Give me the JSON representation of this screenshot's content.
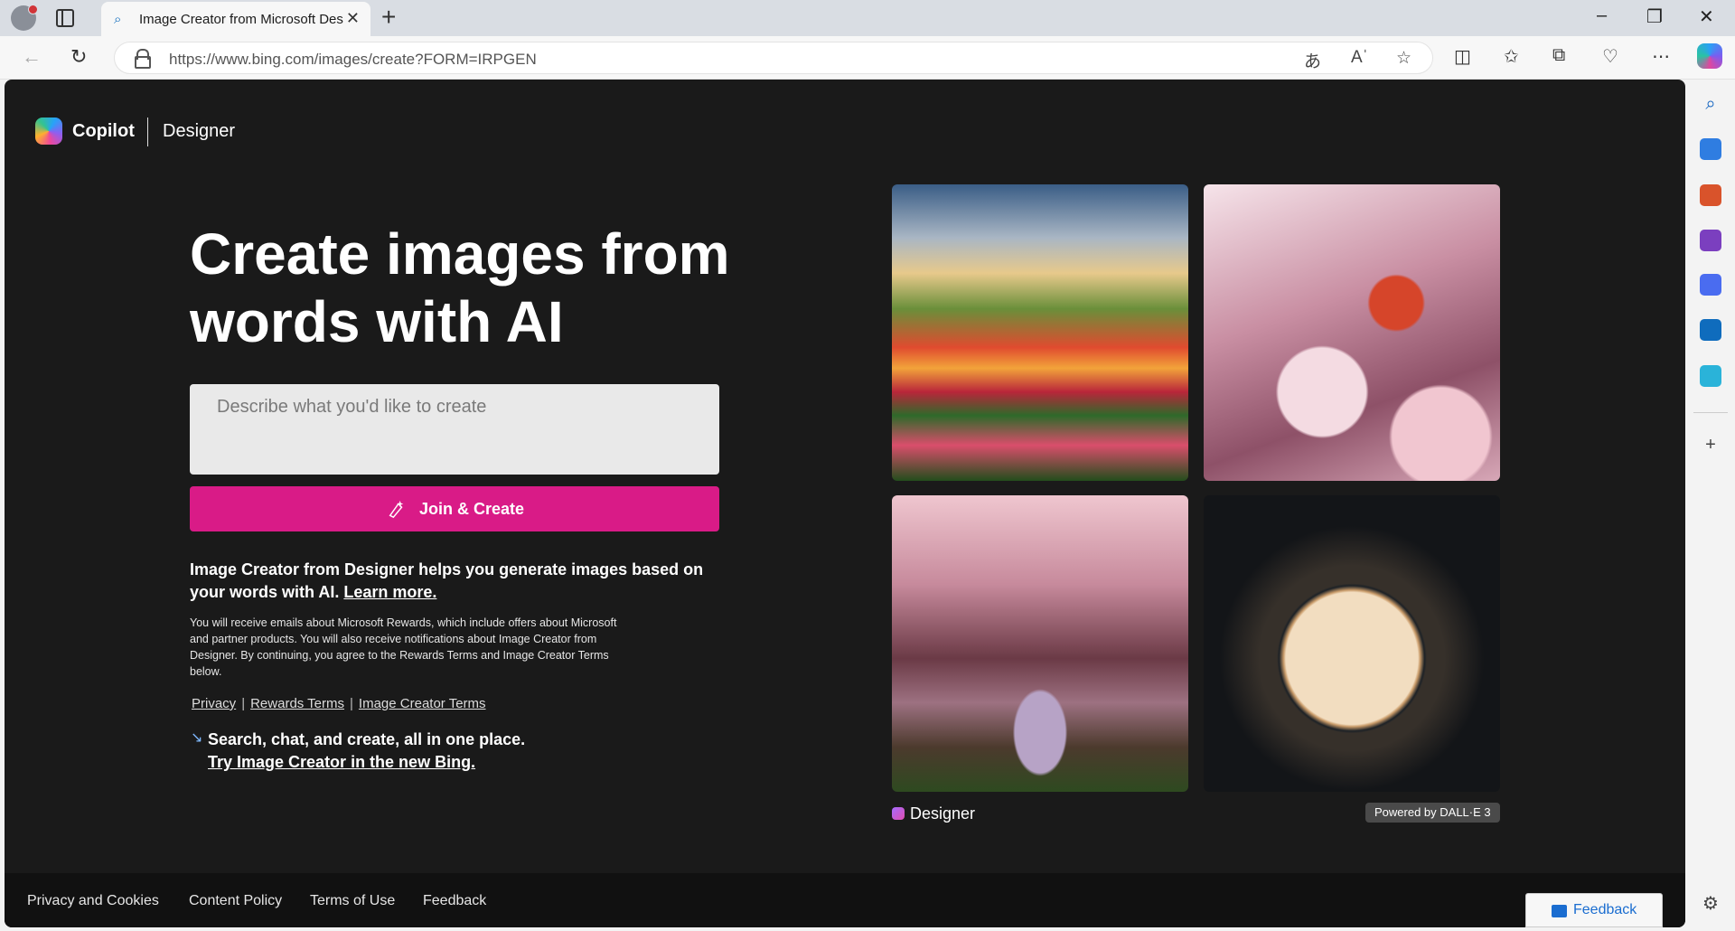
{
  "browser": {
    "tab": {
      "title": "Image Creator from Microsoft Designer",
      "favicon": "search-icon"
    },
    "address": {
      "url": "https://www.bing.com/images/create?FORM=IRPGEN"
    },
    "window_controls": [
      "minimize-icon",
      "restore-icon",
      "close-icon"
    ]
  },
  "page": {
    "brand": {
      "name": "Copilot",
      "product": "Designer"
    },
    "hero": {
      "title": "Create images from words with AI",
      "prompt_placeholder": "Describe what you'd like to create",
      "button_label": "Join & Create"
    },
    "description": {
      "text": "Image Creator from Designer helps you generate images based on your words with AI. ",
      "learn_more": "Learn more."
    },
    "fine_print": "You will receive emails about Microsoft Rewards, which include offers about Microsoft and partner products. You will also receive notifications about Image Creator from Designer. By continuing, you agree to the Rewards Terms and Image Creator Terms below.",
    "legal_links": [
      "Privacy",
      "Rewards Terms",
      "Image Creator Terms"
    ],
    "promo": {
      "line1": "Search, chat, and create, all in one place.",
      "line2": "Try Image Creator in the new Bing."
    },
    "gallery": {
      "images": [
        "tulip-field-image",
        "butterfly-blossom-image",
        "cherry-blossom-river-image",
        "floral-moon-image"
      ],
      "designer_label": "Designer",
      "powered_by": "Powered by DALL·E 3"
    },
    "footer": {
      "links": [
        "Privacy and Cookies",
        "Content Policy",
        "Terms of Use",
        "Feedback"
      ],
      "feedback_button": "Feedback"
    }
  },
  "colors": {
    "page_bg": "#1a1a1a",
    "accent_button": "#d91b87",
    "footer_bg": "#111111",
    "feedback_blue": "#1a6dd0"
  }
}
